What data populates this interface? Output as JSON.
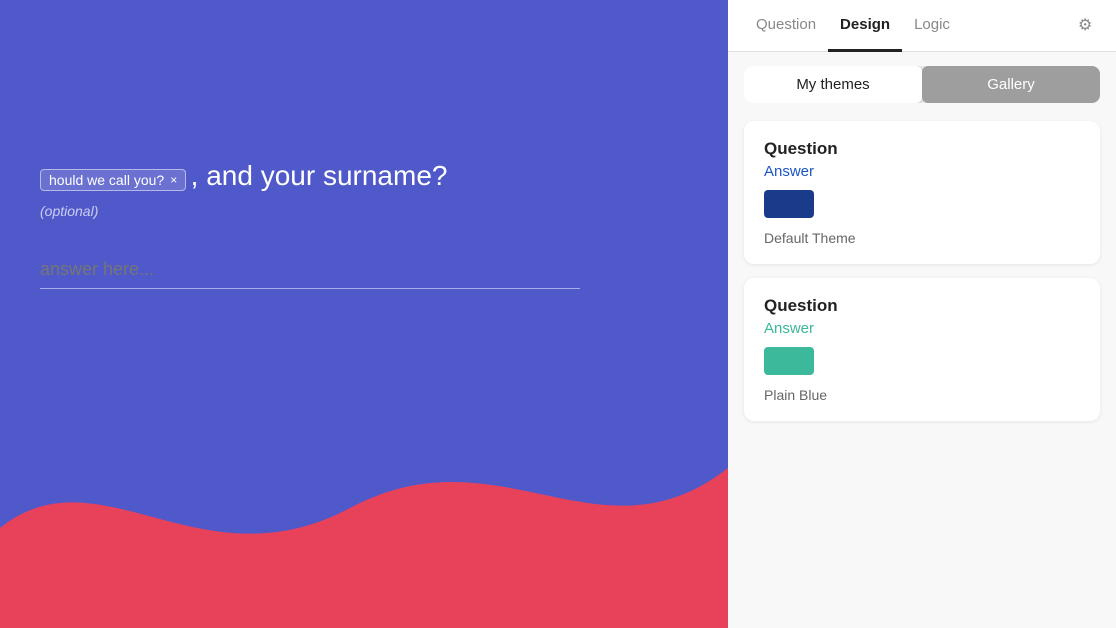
{
  "left": {
    "tag_label": "hould we call you?",
    "tag_close": "×",
    "question_suffix": ", and your surname?",
    "optional_label": "(optional)",
    "answer_placeholder": "answer here..."
  },
  "right": {
    "tabs": [
      {
        "id": "question",
        "label": "Question",
        "active": false
      },
      {
        "id": "design",
        "label": "Design",
        "active": true
      },
      {
        "id": "logic",
        "label": "Logic",
        "active": false
      }
    ],
    "gear_icon": "⚙",
    "theme_toggle": {
      "my_themes_label": "My themes",
      "gallery_label": "Gallery",
      "active": "my_themes"
    },
    "themes": [
      {
        "id": "default",
        "question_label": "Question",
        "answer_label": "Answer",
        "answer_color_class": "blue",
        "swatch_color": "#1a3a8a",
        "name": "Default Theme"
      },
      {
        "id": "plain-blue",
        "question_label": "Question",
        "answer_label": "Answer",
        "answer_color_class": "teal",
        "swatch_color": "#3cb89a",
        "name": "Plain Blue"
      }
    ]
  },
  "colors": {
    "left_bg": "#5059c9",
    "wave_fill": "#e8425a",
    "swatch_default": "#1a3a8a",
    "swatch_plain_blue": "#3cb89a"
  }
}
